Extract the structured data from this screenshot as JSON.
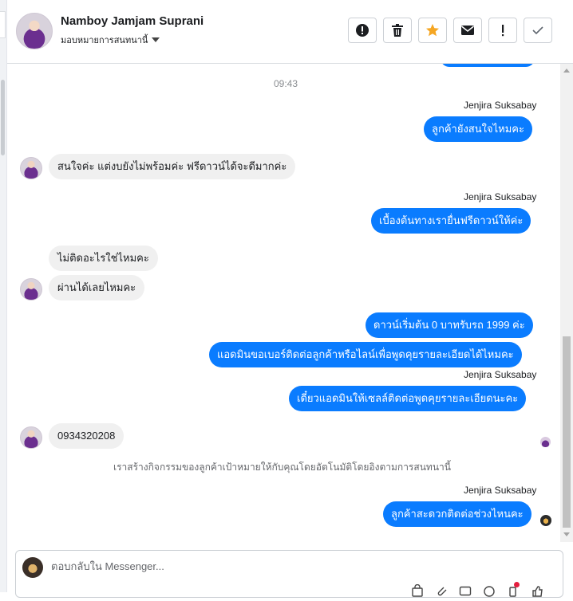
{
  "header": {
    "contact_name": "Namboy Jamjam Suprani",
    "assign_label": "มอบหมายการสนทนานี้",
    "actions": [
      {
        "name": "spam-icon",
        "label": "Spam"
      },
      {
        "name": "trash-icon",
        "label": "Delete"
      },
      {
        "name": "star-icon",
        "label": "Star"
      },
      {
        "name": "envelope-icon",
        "label": "Unread"
      },
      {
        "name": "exclamation-icon",
        "label": "Follow up"
      },
      {
        "name": "checkmark-icon",
        "label": "Done"
      }
    ],
    "star_color": "#f5a623"
  },
  "chat": {
    "time": "09:43",
    "messages": [
      {
        "from": "agent",
        "sender": "Jenjira Suksabay",
        "text": "ลูกค้ายังสนใจไหมคะ"
      },
      {
        "from": "customer",
        "text": "สนใจค่ะ แต่งบยังไม่พร้อมค่ะ ฟรีดาวน์ได้จะดีมากค่ะ"
      },
      {
        "from": "agent",
        "sender": "Jenjira Suksabay",
        "text": "เบื้องต้นทางเรายื่นฟรีดาวน์ให้ค่ะ"
      },
      {
        "from": "customer",
        "text": "ไม่ติดอะไรใช่ไหมคะ"
      },
      {
        "from": "customer",
        "text": "ผ่านได้เลยไหมคะ"
      },
      {
        "from": "agent",
        "text": "ดาวน์เริ่มต้น 0 บาทรับรถ 1999 ค่ะ"
      },
      {
        "from": "agent",
        "text": "แอดมินขอเบอร์ติดต่อลูกค้าหรือไลน์เพื่อพูดคุยรายละเอียดได้ไหมคะ"
      },
      {
        "from": "agent",
        "sender": "Jenjira Suksabay",
        "text": "เดี๋ยวแอดมินให้เซลล์ติดต่อพูดคุยรายละเอียดนะคะ"
      },
      {
        "from": "customer",
        "text": "0934320208"
      },
      {
        "from": "agent",
        "sender": "Jenjira Suksabay",
        "text": "ลูกค้าสะดวกติดต่อช่วงไหนคะ"
      }
    ],
    "system_note": "เราสร้างกิจกรรมของลูกค้าเป้าหมายให้กับคุณโดยอัตโนมัติโดยอิงตามการสนทนานี้",
    "bubble_color": "#0a7cff"
  },
  "composer": {
    "placeholder": "ตอบกลับใน Messenger..."
  }
}
